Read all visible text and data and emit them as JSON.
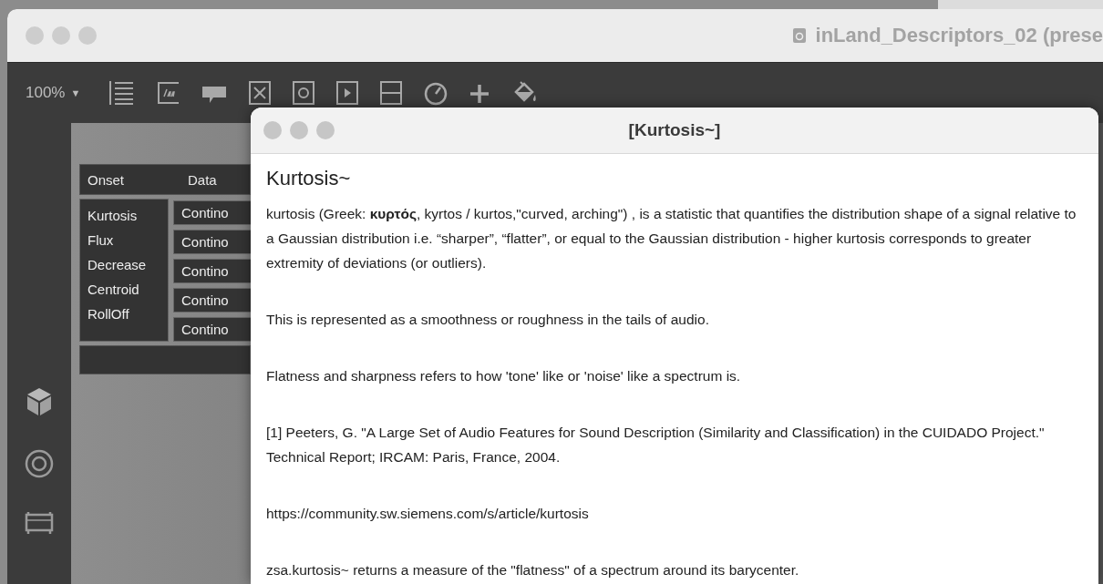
{
  "background_window": {
    "title": "inLand_Descriptors_02 (prese",
    "toolbar": {
      "zoom": "100%",
      "zoom_caret": "▼"
    },
    "table": {
      "columns": [
        "Onset",
        "Data"
      ],
      "rows": [
        {
          "name": "Kurtosis",
          "data": "Contino"
        },
        {
          "name": "Flux",
          "data": "Contino"
        },
        {
          "name": "Decrease",
          "data": "Contino"
        },
        {
          "name": "Centroid",
          "data": "Contino"
        },
        {
          "name": "RollOff",
          "data": "Contino"
        }
      ]
    }
  },
  "help_window": {
    "title": "[Kurtosis~]",
    "heading": "Kurtosis~",
    "paragraphs": [
      "kurtosis (Greek: **κυρτός**, kyrtos / kurtos,\"curved, arching\") , is a statistic that quantifies the distribution shape of a signal relative to a Gaussian distribution i.e. “sharper”, “flatter”, or equal to the Gaussian distribution - higher kurtosis corresponds to greater extremity of deviations (or outliers).",
      "This is represented as a smoothness or roughness in the tails of audio.",
      "Flatness and sharpness refers to how 'tone' like or 'noise' like a spectrum is.",
      "[1] Peeters, G. \"A Large Set of Audio Features for Sound Description (Similarity and Classification) in the CUIDADO Project.\" Technical Report; IRCAM: Paris, France, 2004.",
      "https://community.sw.siemens.com/s/article/kurtosis",
      "zsa.kurtosis~ returns a measure of the \"flatness\" of a spectrum around its barycenter."
    ]
  }
}
